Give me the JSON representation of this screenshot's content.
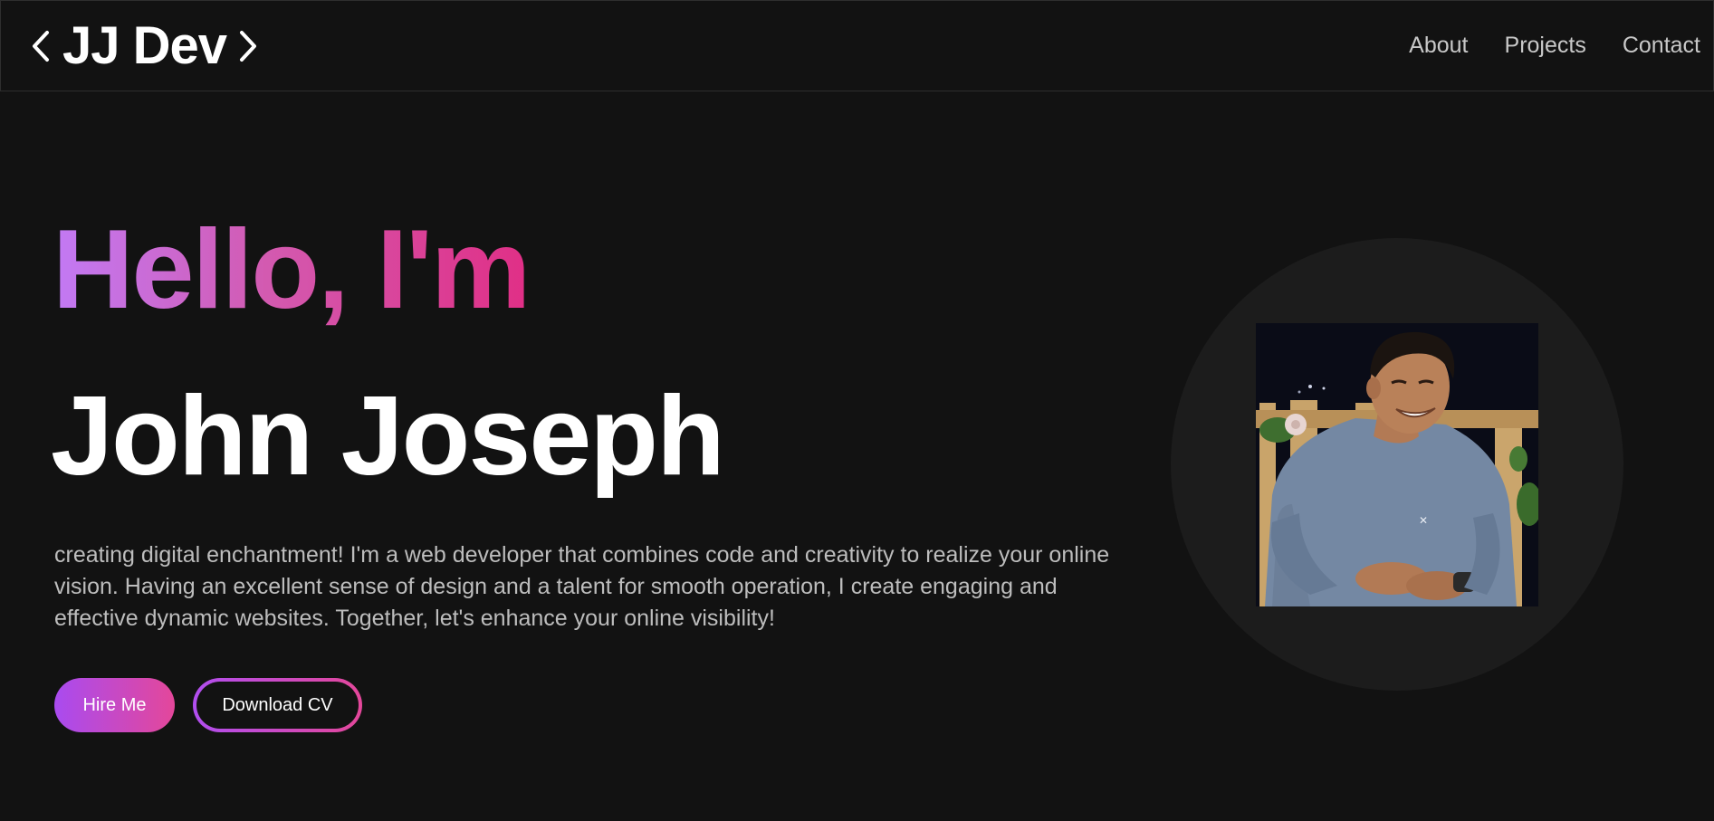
{
  "brand": {
    "left_chevron": "chevron-left-icon",
    "name": "JJ Dev",
    "right_chevron": "chevron-right-icon"
  },
  "nav": {
    "items": [
      {
        "label": "About"
      },
      {
        "label": "Projects"
      },
      {
        "label": "Contact"
      }
    ]
  },
  "hero": {
    "greeting": "Hello, I'm",
    "name": "John Joseph",
    "description": "creating digital enchantment! I'm a web developer that combines code and creativity to realize your online vision. Having an excellent sense of design and a talent for smooth operation, I create engaging and effective dynamic websites. Together, let's enhance your online visibility!",
    "primary_button": "Hire Me",
    "secondary_button": "Download CV"
  },
  "colors": {
    "background": "#121212",
    "gradient_start": "#c27af5",
    "gradient_end": "#e02f86",
    "avatar_circle": "#1c1c1c"
  }
}
